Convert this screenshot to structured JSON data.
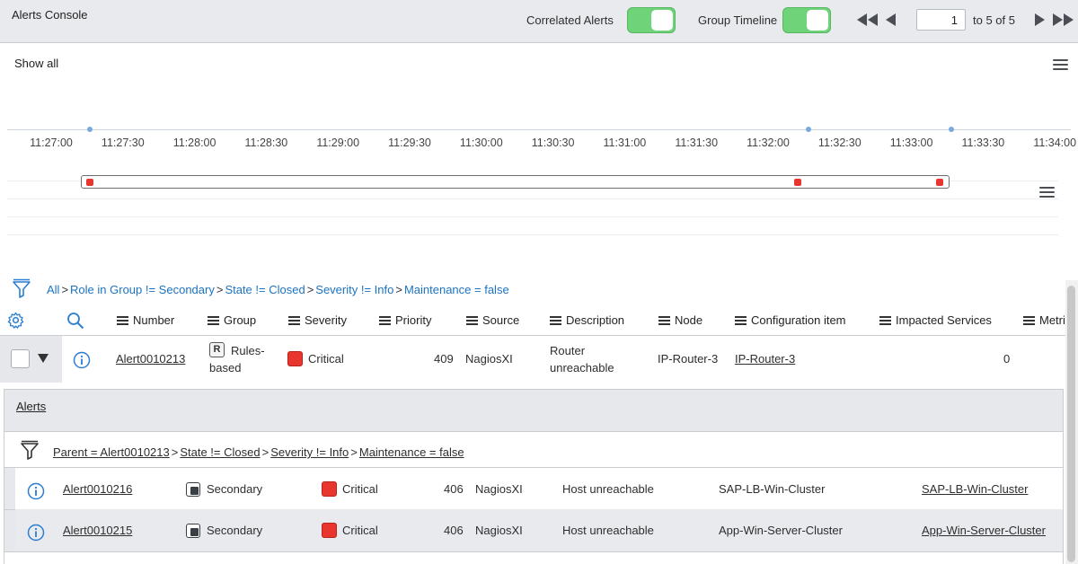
{
  "header": {
    "title": "Alerts Console",
    "correlated_alerts_label": "Correlated Alerts",
    "group_timeline_label": "Group Timeline",
    "correlated_alerts_on": true,
    "group_timeline_on": true,
    "page_value": "1",
    "page_of": "to 5 of 5",
    "toggle_color": "#6fd37a"
  },
  "timeline": {
    "show_all": "Show all",
    "ticks": [
      "11:27:00",
      "11:27:30",
      "11:28:00",
      "11:28:30",
      "11:29:00",
      "11:29:30",
      "11:30:00",
      "11:30:30",
      "11:31:00",
      "11:31:30",
      "11:32:00",
      "11:32:30",
      "11:33:00",
      "11:33:30",
      "11:34:00"
    ],
    "marker_color": "#e8362e"
  },
  "filter": {
    "crumbs": [
      "All",
      "Role in Group != Secondary",
      "State != Closed",
      "Severity != Info",
      "Maintenance = false"
    ],
    "separator": ">"
  },
  "columns": [
    "Number",
    "Group",
    "Severity",
    "Priority",
    "Source",
    "Description",
    "Node",
    "Configuration item",
    "Impacted Services",
    "Metri"
  ],
  "parent_row": {
    "number": "Alert0010213",
    "group_line1": "Rules-",
    "group_line2": "based",
    "group_badge": "R",
    "severity": "Critical",
    "priority": "409",
    "source": "NagiosXI",
    "description_line1": "Router",
    "description_line2": "unreachable",
    "node": "IP-Router-3",
    "configuration_item": "IP-Router-3",
    "impacted_services": "0"
  },
  "child_panel": {
    "title": "Alerts",
    "crumbs": [
      "Parent = Alert0010213",
      "State != Closed",
      "Severity != Info",
      "Maintenance = false"
    ],
    "separator": ">",
    "rows": [
      {
        "number": "Alert0010216",
        "group": "Secondary",
        "severity": "Critical",
        "priority": "406",
        "source": "NagiosXI",
        "description": "Host unreachable",
        "node": "SAP-LB-Win-Cluster",
        "configuration_item": "SAP-LB-Win-Cluster"
      },
      {
        "number": "Alert0010215",
        "group": "Secondary",
        "severity": "Critical",
        "priority": "406",
        "source": "NagiosXI",
        "description": "Host unreachable",
        "node": "App-Win-Server-Cluster",
        "configuration_item": "App-Win-Server-Cluster"
      }
    ]
  },
  "colors": {
    "link": "#1c73c2",
    "critical": "#e8362e"
  }
}
